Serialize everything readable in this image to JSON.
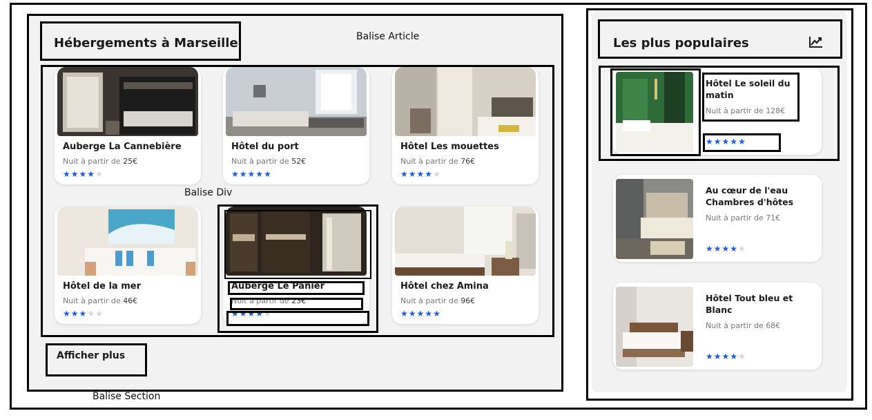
{
  "annotations": {
    "article": "Balise Article",
    "div": "Balise Div",
    "section": "Balise Section"
  },
  "main": {
    "title": "Hébergements à Marseille",
    "show_more": "Afficher plus",
    "price_prefix": "Nuit à partir de",
    "cards": [
      {
        "name": "Auberge La Cannebière",
        "price": "25€",
        "rating": 4,
        "rating_max": 5
      },
      {
        "name": "Hôtel du port",
        "price": "52€",
        "rating": 5,
        "rating_max": 5
      },
      {
        "name": "Hôtel Les mouettes",
        "price": "76€",
        "rating": 4,
        "rating_max": 5
      },
      {
        "name": "Hôtel de la mer",
        "price": "46€",
        "rating": 3,
        "rating_max": 5
      },
      {
        "name": "Auberge Le Panier",
        "price": "23€",
        "rating": 4,
        "rating_max": 5
      },
      {
        "name": "Hôtel chez Amina",
        "price": "96€",
        "rating": 5,
        "rating_max": 5
      }
    ]
  },
  "popular": {
    "title": "Les plus populaires",
    "icon": "trend-chart-icon",
    "price_prefix": "Nuit à partir de",
    "items": [
      {
        "name": "Hôtel Le soleil du matin",
        "price": "128€",
        "rating": 5,
        "rating_max": 5
      },
      {
        "name": "Au cœur de l'eau Chambres d'hôtes",
        "price": "71€",
        "rating": 4,
        "rating_max": 5
      },
      {
        "name": "Hôtel Tout bleu et Blanc",
        "price": "68€",
        "rating": 4,
        "rating_max": 5
      }
    ]
  },
  "colors": {
    "star_on": "#1a5be8",
    "star_off": "#d6d6d6",
    "panel_bg": "#f2f2f2",
    "card_bg": "#ffffff",
    "annotation_border": "#000000"
  }
}
